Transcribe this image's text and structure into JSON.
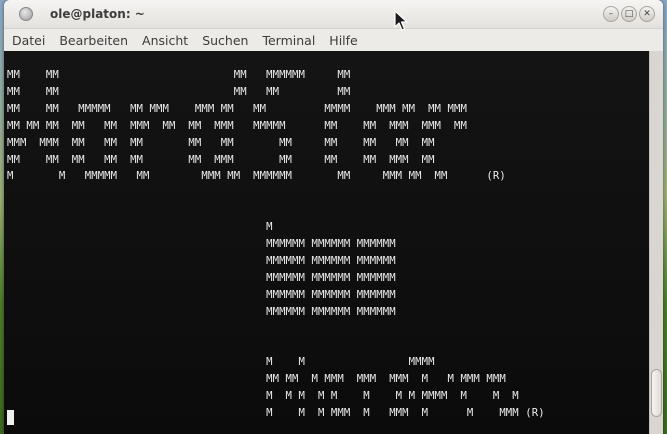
{
  "window": {
    "title": "ole@platon: ~",
    "buttons": {
      "minimize": "–",
      "maximize": "□",
      "close": "✕"
    }
  },
  "menubar": {
    "items": [
      "Datei",
      "Bearbeiten",
      "Ansicht",
      "Suchen",
      "Terminal",
      "Hilfe"
    ]
  },
  "terminal": {
    "lines": [
      "MM    MM                           MM   MMMMMM     MM",
      "MM    MM                           MM   MM         MM",
      "MM    MM   MMMMM   MM MMM    MMM MM   MM         MMMM    MMM MM  MM MMM",
      "MM MM MM  MM   MM  MMM  MM  MM  MMM   MMMMM      MM    MM  MMM  MMM  MM",
      "MMM  MMM  MM   MM  MM       MM   MM       MM     MM    MM   MM  MM",
      "MM    MM  MM   MM  MM       MM  MMM       MM     MM    MM  MMM  MM",
      "M       M   MMMMM   MM        MMM MM  MMMMMM       MM     MMM MM  MM      (R)",
      "",
      "",
      "                                        M",
      "                                        MMMMMM MMMMMM MMMMMM",
      "                                        MMMMMM MMMMMM MMMMMM",
      "                                        MMMMMM MMMMMM MMMMMM",
      "                                        MMMMMM MMMMMM MMMMMM",
      "                                        MMMMMM MMMMMM MMMMMM",
      "",
      "",
      "                                        M    M                MMMM",
      "                                        MM MM  M MMM  MMM  MMM  M   M MMM MMM",
      "                                        M  M M  M M    M    M M MMMM  M    M  M",
      "                                        M    M  M MMM  M   MMM  M      M    MMM (R)"
    ],
    "colors": {
      "background": "#0d0d0c",
      "foreground": "#ededed"
    }
  }
}
